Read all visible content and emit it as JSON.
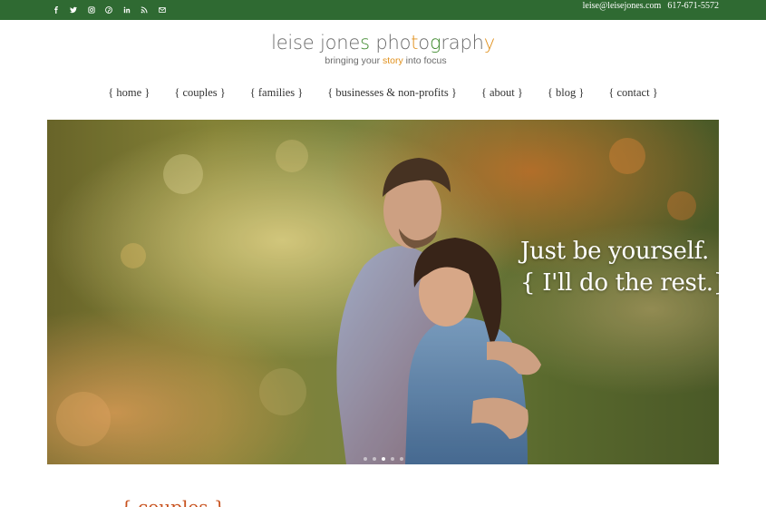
{
  "topbar": {
    "social_icons": [
      "facebook-icon",
      "twitter-icon",
      "instagram-icon",
      "pinterest-icon",
      "linkedin-icon",
      "rss-icon",
      "email-icon"
    ],
    "email": "leise@leisejones.com",
    "phone": "617-671-5572",
    "color": "#2f6a32"
  },
  "logo": {
    "part1": "leise jone",
    "part2": "s",
    "part3": " pho",
    "part4": "t",
    "part5": "o",
    "part6": "g",
    "part7": "raph",
    "part8": "y",
    "tag1": "bringing your ",
    "tag2": "story",
    "tag3": " into focus"
  },
  "nav": {
    "items": [
      "{ home }",
      "{ couples }",
      "{ families }",
      "{ businesses & non-profits }",
      "{ about }",
      "{ blog }",
      "{ contact }"
    ]
  },
  "hero": {
    "line1": "Just be yourself.",
    "line2": "{ I'll do the rest.}",
    "slides": 5,
    "active_slide": 3
  },
  "bottom": {
    "heading": "{ couples }"
  }
}
